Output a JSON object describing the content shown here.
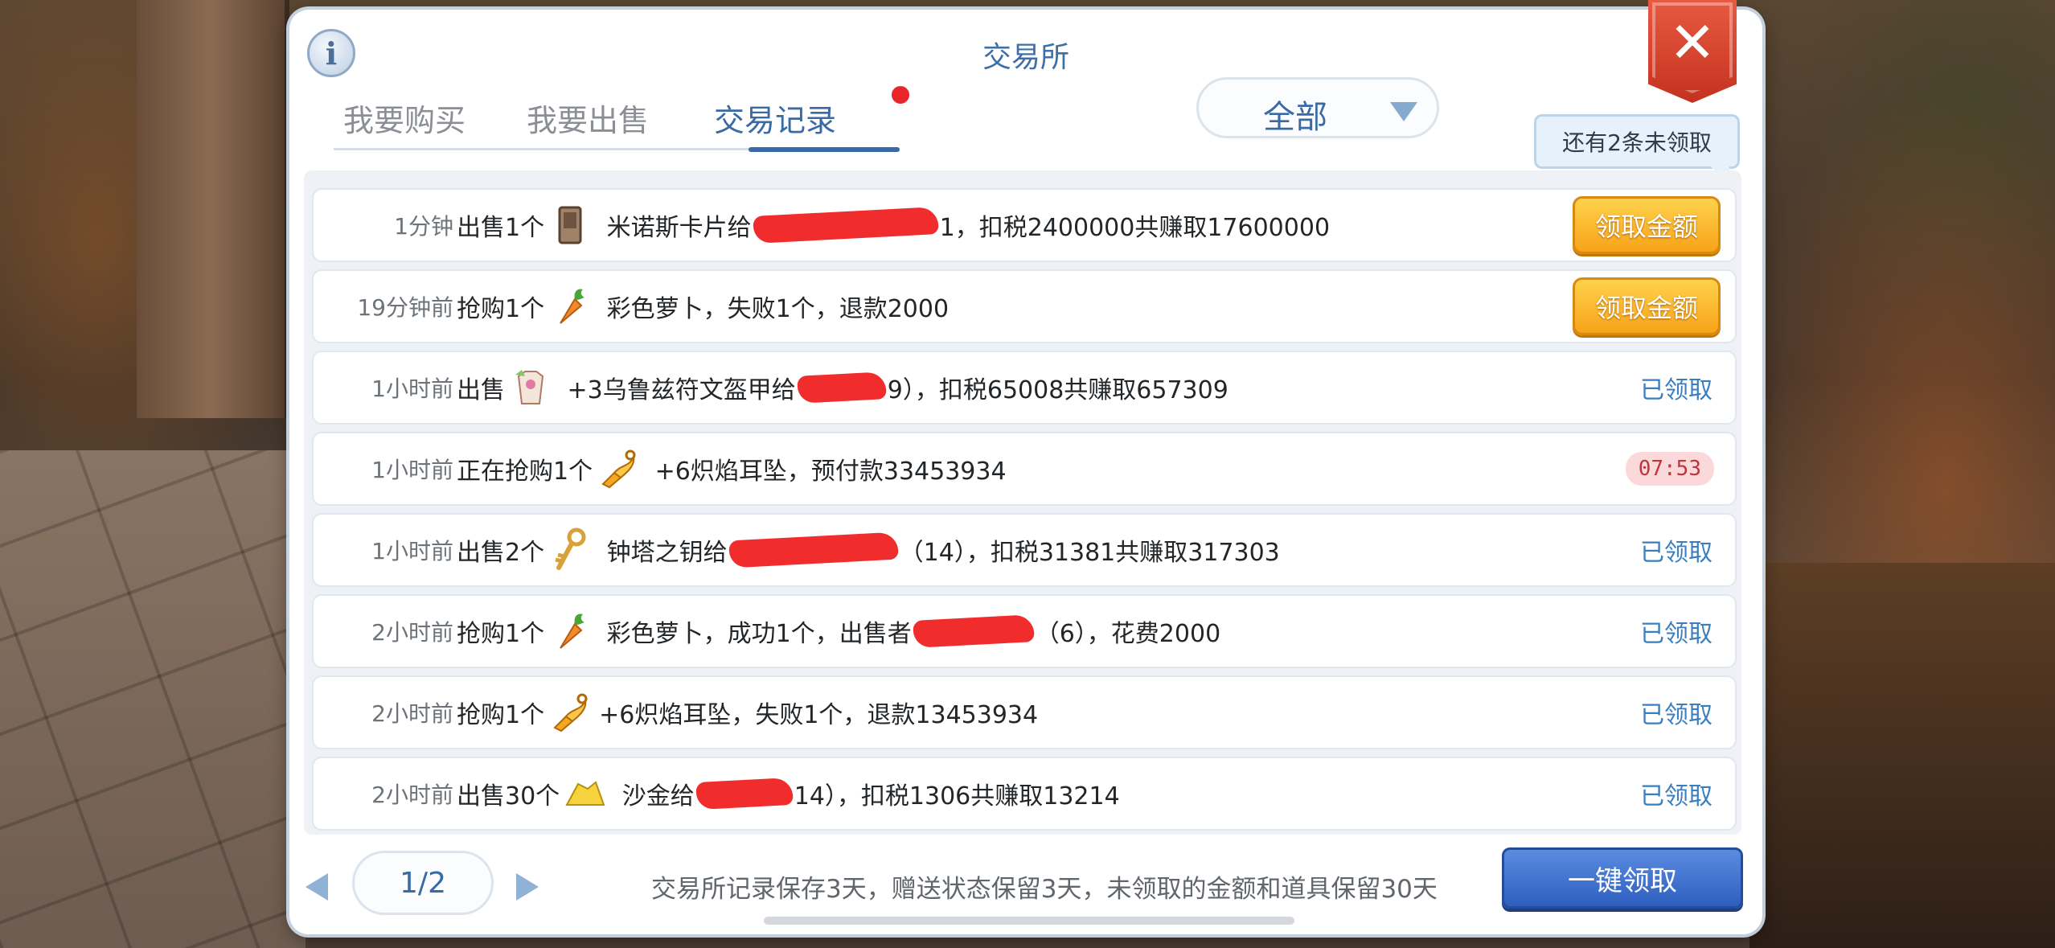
{
  "panel": {
    "title": "交易所",
    "info_icon_glyph": "i"
  },
  "tabs": [
    {
      "label": "我要购买",
      "active": false
    },
    {
      "label": "我要出售",
      "active": false
    },
    {
      "label": "交易记录",
      "active": true
    }
  ],
  "filter": {
    "selected": "全部"
  },
  "tooltip": "还有2条未领取",
  "records": [
    {
      "time": "1分钟",
      "action": "出售1个",
      "icon": "card-icon",
      "desc": " 米诺斯卡片给",
      "desc2": "1，扣税2400000共赚取17600000",
      "status": "button",
      "status_label": "领取金额"
    },
    {
      "time": "19分钟前",
      "action": "抢购1个",
      "icon": "carrot-icon",
      "desc": " 彩色萝卜，失败1个，退款2000",
      "desc2": "",
      "status": "button",
      "status_label": "领取金额"
    },
    {
      "time": "1小时前",
      "action": "出售",
      "icon": "armor-icon",
      "desc": " +3乌鲁兹符文盔甲给",
      "desc2": "9），扣税65008共赚取657309",
      "status": "claimed",
      "status_label": "已领取"
    },
    {
      "time": "1小时前",
      "action": "正在抢购1个",
      "icon": "earring-icon",
      "desc": " +6炽焰耳坠，预付款33453934",
      "desc2": "",
      "status": "timer",
      "status_label": "07:53"
    },
    {
      "time": "1小时前",
      "action": "出售2个",
      "icon": "key-icon",
      "desc": " 钟塔之钥给",
      "desc2": "（14），扣税31381共赚取317303",
      "status": "claimed",
      "status_label": "已领取"
    },
    {
      "time": "2小时前",
      "action": "抢购1个",
      "icon": "carrot-icon",
      "desc": " 彩色萝卜，成功1个，出售者",
      "desc2": "（6），花费2000",
      "status": "claimed",
      "status_label": "已领取"
    },
    {
      "time": "2小时前",
      "action": "抢购1个",
      "icon": "earring-icon",
      "desc": "+6炽焰耳坠，失败1个，退款13453934",
      "desc2": "",
      "status": "claimed",
      "status_label": "已领取"
    },
    {
      "time": "2小时前",
      "action": "出售30个",
      "icon": "gold-sand-icon",
      "desc": " 沙金给",
      "desc2": "14），扣税1306共赚取13214",
      "status": "claimed",
      "status_label": "已领取"
    }
  ],
  "footer": {
    "page": "1/2",
    "note": "交易所记录保存3天，赠送状态保留3天，未领取的金额和道具保留30天",
    "claim_all_label": "一键领取"
  },
  "colors": {
    "accent_blue": "#3a6aa6",
    "claim_button": "#f7a319",
    "claimed_text": "#3a7ec0",
    "timer_bg": "#fbd9db",
    "close_red": "#d23c28"
  }
}
